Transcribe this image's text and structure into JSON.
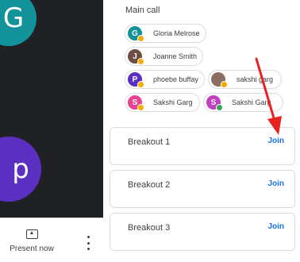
{
  "video_tiles": [
    {
      "letter": "G",
      "color": "#12939a"
    },
    {
      "letter": "p",
      "color": "#5b2fc2"
    }
  ],
  "bottom_bar": {
    "present_label": "Present now",
    "more_icon": "more-vert-icon"
  },
  "main_call": {
    "title": "Main call",
    "participants": [
      {
        "name": "Gloria Melrose",
        "initial": "G",
        "avatar_color": "#12939a",
        "status_color": "#f9ab00"
      },
      {
        "name": "Joanne Smith",
        "initial": "J",
        "avatar_color": "#6d4c41",
        "status_color": "#f9ab00"
      },
      {
        "name": "phoebe buffay",
        "initial": "P",
        "avatar_color": "#5b2fc2",
        "status_color": "#f9ab00"
      },
      {
        "name": "sakshi garg",
        "initial": "",
        "avatar_color": "#8d6e63",
        "status_color": "#f9ab00"
      },
      {
        "name": "Sakshi Garg",
        "initial": "S",
        "avatar_color": "#e84393",
        "status_color": "#f9ab00"
      },
      {
        "name": "Sakshi Garg",
        "initial": "S",
        "avatar_color": "#c040c0",
        "status_color": "#34a853"
      }
    ]
  },
  "breakout_rooms": [
    {
      "name": "Breakout 1",
      "join_label": "Join"
    },
    {
      "name": "Breakout 2",
      "join_label": "Join"
    },
    {
      "name": "Breakout 3",
      "join_label": "Join"
    }
  ],
  "colors": {
    "accent": "#1a73e8",
    "annotation_arrow": "#e8231f"
  }
}
